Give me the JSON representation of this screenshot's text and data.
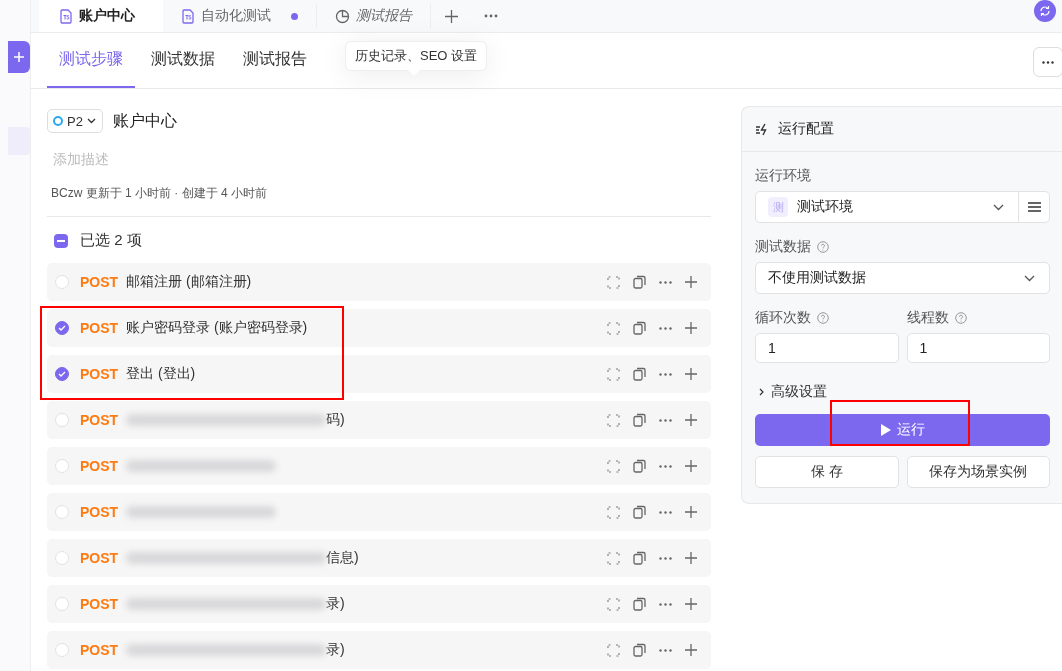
{
  "doc_tabs": [
    {
      "label": "账户中心",
      "kind": "case",
      "selected": true,
      "unsaved": false,
      "preview": false
    },
    {
      "label": "自动化测试",
      "kind": "case",
      "selected": false,
      "unsaved": true,
      "preview": false
    },
    {
      "label": "测试报告",
      "kind": "report",
      "selected": false,
      "unsaved": false,
      "preview": true
    }
  ],
  "sub_tabs": [
    {
      "label": "测试步骤",
      "selected": true
    },
    {
      "label": "测试数据",
      "selected": false
    },
    {
      "label": "测试报告",
      "selected": false
    }
  ],
  "tooltip": "历史记录、SEO 设置",
  "case": {
    "priority": "P2",
    "title": "账户中心",
    "description_placeholder": "添加描述",
    "meta": "BCzw 更新于 1 小时前 · 创建于 4 小时前"
  },
  "selection": {
    "label": "已选 2 项",
    "partial": true
  },
  "steps": [
    {
      "method": "POST",
      "name": "邮箱注册 (邮箱注册)",
      "checked": false,
      "highlighted": false,
      "redacted": false
    },
    {
      "method": "POST",
      "name": "账户密码登录 (账户密码登录)",
      "checked": true,
      "highlighted": true,
      "redacted": false
    },
    {
      "method": "POST",
      "name": "登出 (登出)",
      "checked": true,
      "highlighted": true,
      "redacted": false
    },
    {
      "method": "POST",
      "name": "码)",
      "checked": false,
      "highlighted": false,
      "redacted": true
    },
    {
      "method": "POST",
      "checked": false,
      "highlighted": false,
      "redacted": true
    },
    {
      "method": "POST",
      "checked": false,
      "highlighted": false,
      "redacted": true
    },
    {
      "method": "POST",
      "name": "信息)",
      "checked": false,
      "highlighted": false,
      "redacted": true
    },
    {
      "method": "POST",
      "name": "录)",
      "checked": false,
      "highlighted": false,
      "redacted": true
    },
    {
      "method": "POST",
      "name": "录)",
      "checked": false,
      "highlighted": false,
      "redacted": true
    }
  ],
  "run_config": {
    "title": "运行配置",
    "environment": {
      "label": "运行环境",
      "badge": "测",
      "value": "测试环境"
    },
    "test_data": {
      "label": "测试数据",
      "value": "不使用测试数据"
    },
    "loops": {
      "label": "循环次数",
      "value": "1"
    },
    "threads": {
      "label": "线程数",
      "value": "1"
    },
    "advanced": {
      "label": "高级设置",
      "expanded": false
    },
    "run_button": {
      "label": "运行",
      "highlighted": true
    },
    "buttons": [
      "保 存",
      "保存为场景实例"
    ]
  }
}
